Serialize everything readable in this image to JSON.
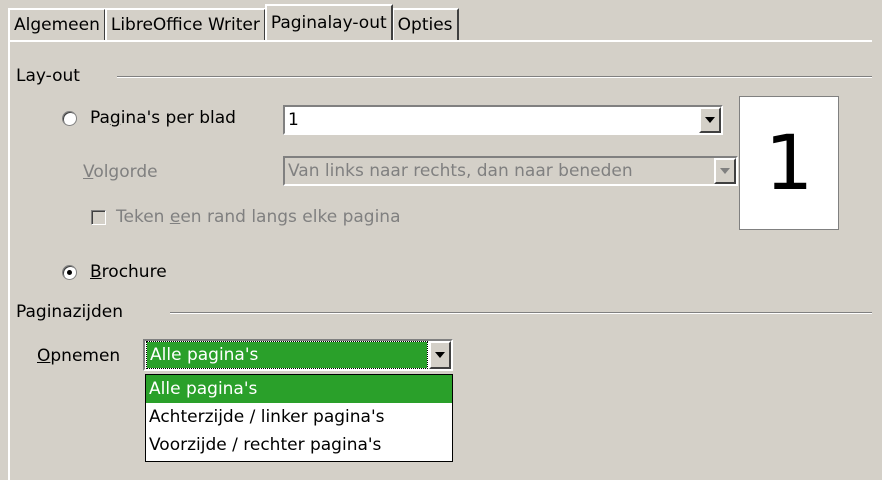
{
  "tabs": [
    {
      "label": "Algemeen",
      "active": false
    },
    {
      "label": "LibreOffice Writer",
      "active": false
    },
    {
      "label": "Paginalay-out",
      "active": true
    },
    {
      "label": "Opties",
      "active": false
    }
  ],
  "layout": {
    "title": "Lay-out",
    "pages_per_sheet": {
      "label_pre": "Pa",
      "label_ul": "g",
      "label_post": "ina's per blad",
      "value": "1",
      "selected": false
    },
    "order": {
      "label_ul": "V",
      "label_post": "olgorde",
      "value": "Van links naar rechts, dan naar beneden",
      "enabled": false
    },
    "draw_border": {
      "label_pre": "Teken ",
      "label_ul": "e",
      "label_post": "en rand langs elke pagina",
      "checked": false,
      "enabled": false
    },
    "brochure": {
      "label_ul": "B",
      "label_post": "rochure",
      "selected": true
    },
    "preview_number": "1"
  },
  "page_sides": {
    "title": "Paginazijden",
    "include": {
      "label_ul": "O",
      "label_post": "pnemen",
      "value": "Alle pagina's",
      "options": [
        "Alle pagina's",
        "Achterzijde / linker pagina's",
        "Voorzijde / rechter pagina's"
      ],
      "selected_index": 0
    }
  },
  "colors": {
    "dialog_bg": "#d4d0c8",
    "selection_bg": "#2aa02a",
    "selection_fg": "#ffffff",
    "disabled_fg": "#808080"
  }
}
